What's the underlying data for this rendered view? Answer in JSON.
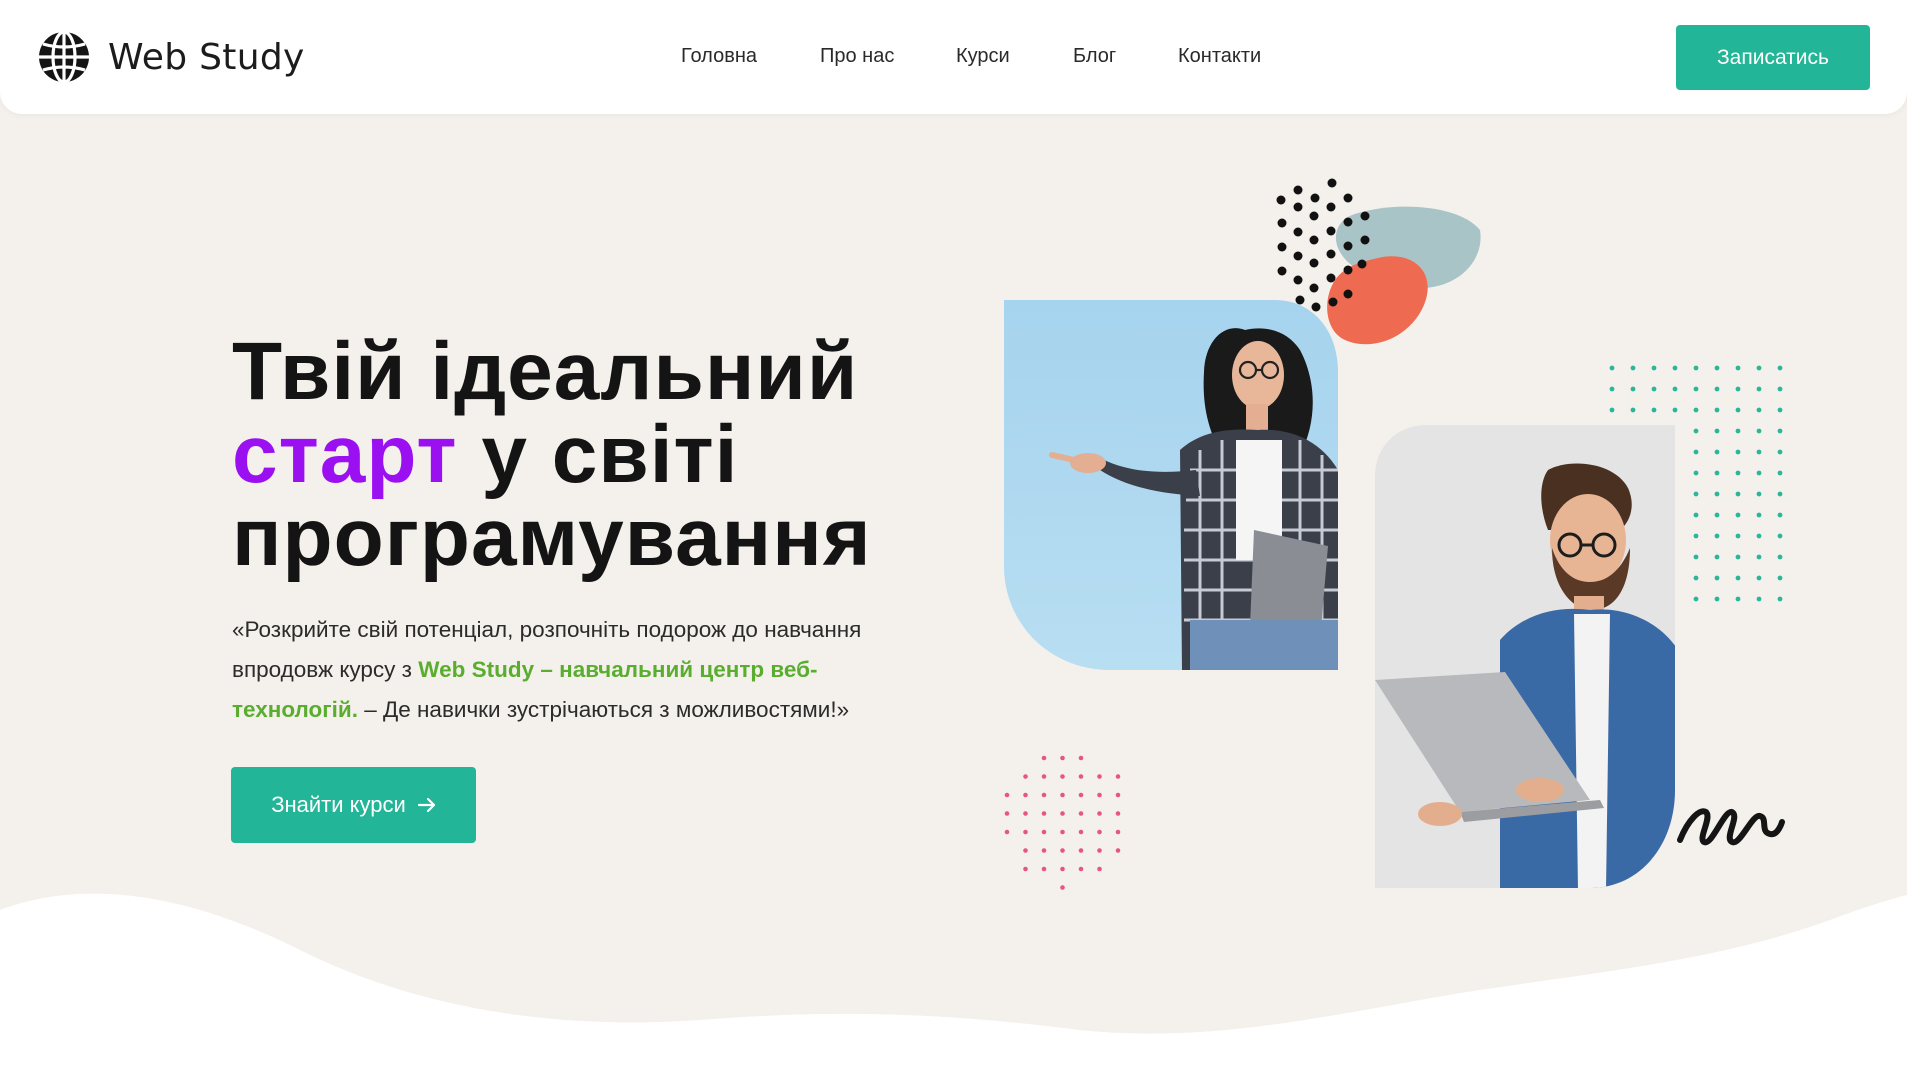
{
  "brand": {
    "name": "Web Study",
    "logo_icon": "globe-icon"
  },
  "nav": {
    "items": [
      {
        "label": "Головна"
      },
      {
        "label": "Про нас"
      },
      {
        "label": "Курси"
      },
      {
        "label": "Блог"
      },
      {
        "label": "Контакти"
      }
    ],
    "cta_label": "Записатись"
  },
  "hero": {
    "headline_line1": "Твій ідеальний",
    "headline_accent": "старт",
    "headline_line2_rest": " у світі",
    "headline_line3": "програмування",
    "description_before": "«Розкрийте свій потенціал, розпочніть подорож до навчання впродовж курсу з ",
    "description_highlight": "Web Study – навчальний центр веб-технологій.",
    "description_after": " – Де навички зустрічаються з можливостями!»",
    "button_label": "Знайти курси",
    "button_icon": "arrow-right-icon"
  },
  "images": {
    "woman_photo": "woman-pointing-photo",
    "man_photo": "man-with-laptop-photo"
  },
  "colors": {
    "accent": "#22b597",
    "headline_accent": "#9b10f0",
    "highlight_text": "#5aad2e",
    "hero_background": "#f4f1ec",
    "coral_blob": "#ee6a50",
    "gray_blob": "#a9c4c7",
    "teal_dots": "#2bb69a",
    "pink_dots": "#e8577a"
  }
}
